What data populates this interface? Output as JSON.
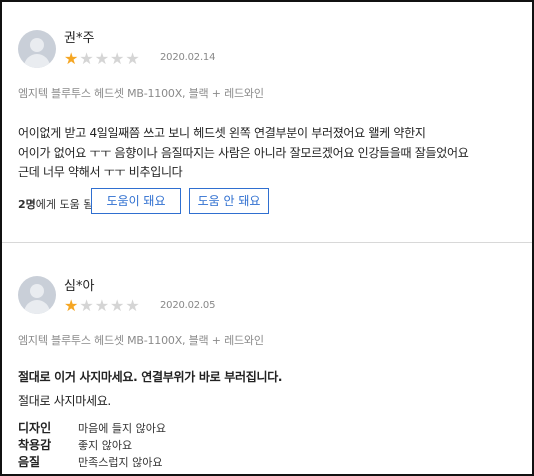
{
  "reviews": [
    {
      "name": "권*주",
      "rating": 1,
      "max_rating": 5,
      "date": "2020.02.14",
      "option": "엠지텍 블루투스 헤드셋 MB-1100X, 블랙 + 레드와인",
      "body_lines": [
        "어이없게 받고 4일일째쯤 쓰고 보니 헤드셋 왼쪽 연결부분이 부러졌어요 왤케 약한지",
        "어이가 없어요 ㅜㅜ 음향이나 음질따지는 사람은 아니라 잘모르겠어요 인강들을때 잘들었어요",
        "근데 너무 약해서 ㅜㅜ 비추입니다"
      ],
      "helpful_count": "2명",
      "helpful_suffix": "에게 도움 됨",
      "helpful_yes_label": "도움이 돼요",
      "helpful_no_label": "도움 안 돼요"
    },
    {
      "name": "심*아",
      "rating": 1,
      "max_rating": 5,
      "date": "2020.02.05",
      "option": "엠지텍 블루투스 헤드셋 MB-1100X, 블랙 + 레드와인",
      "headline": "절대로 이거 사지마세요. 연결부위가 바로 부러집니다.",
      "body_lines": [
        "절대로 사지마세요."
      ],
      "attributes": [
        {
          "label": "디자인",
          "value": "마음에 들지 않아요"
        },
        {
          "label": "착용감",
          "value": "좋지 않아요"
        },
        {
          "label": "음질",
          "value": "만족스럽지 않아요"
        }
      ]
    }
  ],
  "colors": {
    "star_on": "#f5a623",
    "star_off": "#d5d5d5",
    "button_accent": "#2f6fd0"
  }
}
